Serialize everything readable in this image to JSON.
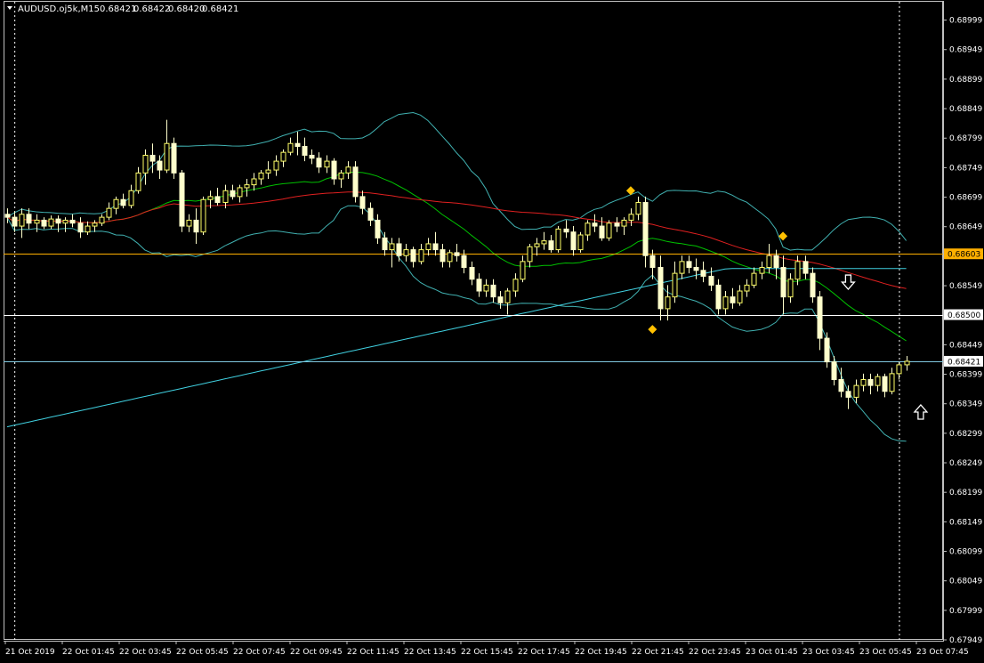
{
  "header": {
    "symbol": "AUDUSD.oj5k,M15",
    "open": "0.68421",
    "high": "0.68422",
    "low": "0.68420",
    "close": "0.68421"
  },
  "colors": {
    "background": "#000000",
    "grid_frame": "#c0c0c0",
    "bull_candle": "#ffff66",
    "bear_candle": "#ffffcc",
    "bollinger": "#40b0b0",
    "ma_green": "#00c000",
    "ma_red": "#e02020",
    "ma_cyan": "#40d0e0",
    "hline_orange": "#ffb000",
    "hline_white": "#ffffff",
    "hline_bid": "#80c8e0",
    "diamond": "#ffc000",
    "arrow": "#ffffff"
  },
  "chart_data": {
    "type": "candlestick",
    "title": "AUDUSD.oj5k,M15",
    "ylim": [
      0.67949,
      0.69024
    ],
    "y_ticks": [
      "0.68999",
      "0.68949",
      "0.68899",
      "0.68849",
      "0.68799",
      "0.68749",
      "0.68699",
      "0.68649",
      "0.68599",
      "0.68549",
      "0.68499",
      "0.68449",
      "0.68399",
      "0.68349",
      "0.68299",
      "0.68249",
      "0.68199",
      "0.68149",
      "0.68099",
      "0.68049",
      "0.67999",
      "0.67949"
    ],
    "x_ticks": [
      "21 Oct 2019",
      "22 Oct 01:45",
      "22 Oct 03:45",
      "22 Oct 05:45",
      "22 Oct 07:45",
      "22 Oct 09:45",
      "22 Oct 11:45",
      "22 Oct 13:45",
      "22 Oct 15:45",
      "22 Oct 17:45",
      "22 Oct 19:45",
      "22 Oct 21:45",
      "22 Oct 23:45",
      "23 Oct 01:45",
      "23 Oct 03:45",
      "23 Oct 05:45",
      "23 Oct 07:45"
    ],
    "price_labels": [
      {
        "name": "level-orange",
        "value": "0.68603",
        "price": 0.68603,
        "color": "#ffb000",
        "text_color": "#000000"
      },
      {
        "name": "level-white",
        "value": "0.68500",
        "price": 0.685,
        "color": "#ffffff",
        "text_color": "#000000"
      },
      {
        "name": "bid",
        "value": "0.68421",
        "price": 0.68421,
        "color": "#ffffff",
        "text_color": "#000000"
      }
    ],
    "period_separators_x_index": [
      1,
      123
    ],
    "candles_ohlc": [
      [
        0.6867,
        0.6868,
        0.68655,
        0.68665
      ],
      [
        0.68665,
        0.68675,
        0.6864,
        0.6865
      ],
      [
        0.6865,
        0.6868,
        0.6863,
        0.6867
      ],
      [
        0.6867,
        0.6868,
        0.68645,
        0.68655
      ],
      [
        0.68655,
        0.6867,
        0.6864,
        0.6866
      ],
      [
        0.6866,
        0.68665,
        0.68645,
        0.6865
      ],
      [
        0.6865,
        0.68668,
        0.68645,
        0.68662
      ],
      [
        0.68662,
        0.68668,
        0.6864,
        0.68655
      ],
      [
        0.68655,
        0.68665,
        0.6864,
        0.6866
      ],
      [
        0.6866,
        0.6867,
        0.68648,
        0.68655
      ],
      [
        0.68655,
        0.68665,
        0.6863,
        0.6864
      ],
      [
        0.6864,
        0.68658,
        0.68635,
        0.6865
      ],
      [
        0.6865,
        0.6866,
        0.6864,
        0.68655
      ],
      [
        0.68655,
        0.6867,
        0.6865,
        0.68665
      ],
      [
        0.68665,
        0.6869,
        0.6866,
        0.6868
      ],
      [
        0.6868,
        0.687,
        0.6867,
        0.68695
      ],
      [
        0.68695,
        0.68705,
        0.6868,
        0.68685
      ],
      [
        0.68685,
        0.6872,
        0.6868,
        0.6871
      ],
      [
        0.6871,
        0.6875,
        0.68705,
        0.6874
      ],
      [
        0.6874,
        0.6878,
        0.6872,
        0.6877
      ],
      [
        0.6877,
        0.6879,
        0.6874,
        0.6876
      ],
      [
        0.6876,
        0.6877,
        0.6873,
        0.68745
      ],
      [
        0.68745,
        0.6883,
        0.6874,
        0.6879
      ],
      [
        0.6879,
        0.688,
        0.6873,
        0.6874
      ],
      [
        0.6874,
        0.68745,
        0.6864,
        0.6865
      ],
      [
        0.6865,
        0.6867,
        0.6864,
        0.6866
      ],
      [
        0.6866,
        0.6868,
        0.6862,
        0.6864
      ],
      [
        0.6864,
        0.687,
        0.68635,
        0.68695
      ],
      [
        0.68695,
        0.6871,
        0.6868,
        0.687
      ],
      [
        0.687,
        0.68715,
        0.68685,
        0.6869
      ],
      [
        0.6869,
        0.6872,
        0.6868,
        0.6871
      ],
      [
        0.6871,
        0.6872,
        0.68695,
        0.687
      ],
      [
        0.687,
        0.6872,
        0.6869,
        0.68715
      ],
      [
        0.68715,
        0.6873,
        0.687,
        0.6872
      ],
      [
        0.6872,
        0.6874,
        0.6871,
        0.6873
      ],
      [
        0.6873,
        0.68745,
        0.6872,
        0.6874
      ],
      [
        0.6874,
        0.6876,
        0.6873,
        0.68745
      ],
      [
        0.68745,
        0.6877,
        0.68735,
        0.6876
      ],
      [
        0.6876,
        0.6878,
        0.6875,
        0.68775
      ],
      [
        0.68775,
        0.688,
        0.6877,
        0.6879
      ],
      [
        0.6879,
        0.6881,
        0.6877,
        0.68785
      ],
      [
        0.68785,
        0.688,
        0.6876,
        0.6877
      ],
      [
        0.6877,
        0.6878,
        0.68755,
        0.68765
      ],
      [
        0.68765,
        0.68775,
        0.6874,
        0.6875
      ],
      [
        0.6875,
        0.6877,
        0.6874,
        0.6876
      ],
      [
        0.6876,
        0.68765,
        0.6872,
        0.6873
      ],
      [
        0.6873,
        0.68745,
        0.68715,
        0.6874
      ],
      [
        0.6874,
        0.6876,
        0.6873,
        0.6875
      ],
      [
        0.6875,
        0.6876,
        0.6869,
        0.687
      ],
      [
        0.687,
        0.6871,
        0.6867,
        0.6868
      ],
      [
        0.6868,
        0.6869,
        0.6865,
        0.6866
      ],
      [
        0.6866,
        0.6867,
        0.6862,
        0.6863
      ],
      [
        0.6863,
        0.6864,
        0.686,
        0.6861
      ],
      [
        0.6861,
        0.6863,
        0.6858,
        0.6862
      ],
      [
        0.6862,
        0.6863,
        0.6859,
        0.686
      ],
      [
        0.686,
        0.6862,
        0.6859,
        0.6861
      ],
      [
        0.6861,
        0.68615,
        0.6858,
        0.6859
      ],
      [
        0.6859,
        0.6862,
        0.68585,
        0.6861
      ],
      [
        0.6861,
        0.6863,
        0.686,
        0.6862
      ],
      [
        0.6862,
        0.6864,
        0.686,
        0.6861
      ],
      [
        0.6861,
        0.6862,
        0.6858,
        0.6859
      ],
      [
        0.6859,
        0.6861,
        0.6858,
        0.68605
      ],
      [
        0.68605,
        0.6862,
        0.6859,
        0.686
      ],
      [
        0.686,
        0.6861,
        0.6857,
        0.6858
      ],
      [
        0.6858,
        0.6859,
        0.6855,
        0.6856
      ],
      [
        0.6856,
        0.6857,
        0.6853,
        0.6854
      ],
      [
        0.6854,
        0.6856,
        0.6853,
        0.6855
      ],
      [
        0.6855,
        0.6856,
        0.6852,
        0.6853
      ],
      [
        0.6853,
        0.6854,
        0.6851,
        0.6852
      ],
      [
        0.6852,
        0.68545,
        0.685,
        0.6854
      ],
      [
        0.6854,
        0.6857,
        0.6853,
        0.6856
      ],
      [
        0.6856,
        0.686,
        0.68555,
        0.6859
      ],
      [
        0.6859,
        0.6862,
        0.6858,
        0.68615
      ],
      [
        0.68615,
        0.6863,
        0.686,
        0.6862
      ],
      [
        0.6862,
        0.6864,
        0.6861,
        0.68625
      ],
      [
        0.68625,
        0.68635,
        0.68605,
        0.6861
      ],
      [
        0.6861,
        0.6865,
        0.68605,
        0.68645
      ],
      [
        0.68645,
        0.6866,
        0.6863,
        0.6864
      ],
      [
        0.6864,
        0.6865,
        0.686,
        0.6861
      ],
      [
        0.6861,
        0.6864,
        0.68605,
        0.68635
      ],
      [
        0.68635,
        0.6866,
        0.68625,
        0.68655
      ],
      [
        0.68655,
        0.6867,
        0.6864,
        0.6865
      ],
      [
        0.6865,
        0.68665,
        0.68625,
        0.6863
      ],
      [
        0.6863,
        0.6866,
        0.68625,
        0.68655
      ],
      [
        0.68655,
        0.68665,
        0.6864,
        0.6865
      ],
      [
        0.6865,
        0.68665,
        0.68635,
        0.6866
      ],
      [
        0.6866,
        0.6868,
        0.6865,
        0.6867
      ],
      [
        0.6867,
        0.687,
        0.6866,
        0.6869
      ],
      [
        0.6869,
        0.687,
        0.6858,
        0.686
      ],
      [
        0.686,
        0.6861,
        0.6856,
        0.6858
      ],
      [
        0.6858,
        0.686,
        0.6849,
        0.6851
      ],
      [
        0.6851,
        0.6855,
        0.6849,
        0.6853
      ],
      [
        0.6853,
        0.6859,
        0.6852,
        0.6857
      ],
      [
        0.6857,
        0.686,
        0.6856,
        0.6859
      ],
      [
        0.6859,
        0.686,
        0.6857,
        0.6858
      ],
      [
        0.6858,
        0.68595,
        0.6856,
        0.68575
      ],
      [
        0.68575,
        0.6859,
        0.68555,
        0.68565
      ],
      [
        0.68565,
        0.6858,
        0.6854,
        0.6855
      ],
      [
        0.6855,
        0.6856,
        0.685,
        0.6851
      ],
      [
        0.6851,
        0.6854,
        0.685,
        0.6853
      ],
      [
        0.6853,
        0.68545,
        0.6851,
        0.6852
      ],
      [
        0.6852,
        0.6855,
        0.68515,
        0.6854
      ],
      [
        0.6854,
        0.6856,
        0.6853,
        0.6855
      ],
      [
        0.6855,
        0.6858,
        0.68545,
        0.6857
      ],
      [
        0.6857,
        0.6859,
        0.6856,
        0.6858
      ],
      [
        0.6858,
        0.6862,
        0.6857,
        0.686
      ],
      [
        0.686,
        0.6861,
        0.6856,
        0.6858
      ],
      [
        0.6858,
        0.686,
        0.685,
        0.6853
      ],
      [
        0.6853,
        0.6857,
        0.6852,
        0.6856
      ],
      [
        0.6856,
        0.686,
        0.6855,
        0.6859
      ],
      [
        0.6859,
        0.686,
        0.6856,
        0.6857
      ],
      [
        0.6857,
        0.6858,
        0.6852,
        0.6853
      ],
      [
        0.6853,
        0.6854,
        0.6844,
        0.6846
      ],
      [
        0.6846,
        0.6847,
        0.6841,
        0.6842
      ],
      [
        0.6842,
        0.6843,
        0.6838,
        0.6839
      ],
      [
        0.6839,
        0.6841,
        0.6836,
        0.6837
      ],
      [
        0.6837,
        0.6838,
        0.6834,
        0.6836
      ],
      [
        0.6836,
        0.6839,
        0.6835,
        0.6838
      ],
      [
        0.6838,
        0.684,
        0.6837,
        0.6839
      ],
      [
        0.6839,
        0.684,
        0.68365,
        0.6838
      ],
      [
        0.6838,
        0.684,
        0.6837,
        0.68395
      ],
      [
        0.68395,
        0.684,
        0.6836,
        0.6837
      ],
      [
        0.6837,
        0.6841,
        0.68365,
        0.684
      ],
      [
        0.684,
        0.6842,
        0.6839,
        0.68415
      ],
      [
        0.68415,
        0.6843,
        0.68405,
        0.68421
      ]
    ],
    "markers": [
      {
        "type": "diamond",
        "index": 86,
        "price": 0.6871
      },
      {
        "type": "diamond",
        "index": 89,
        "price": 0.68475
      },
      {
        "type": "diamond",
        "index": 107,
        "price": 0.68633
      },
      {
        "type": "arrow-down",
        "index": 116,
        "price": 0.68555
      },
      {
        "type": "arrow-up",
        "index": 126,
        "price": 0.68335
      }
    ]
  }
}
